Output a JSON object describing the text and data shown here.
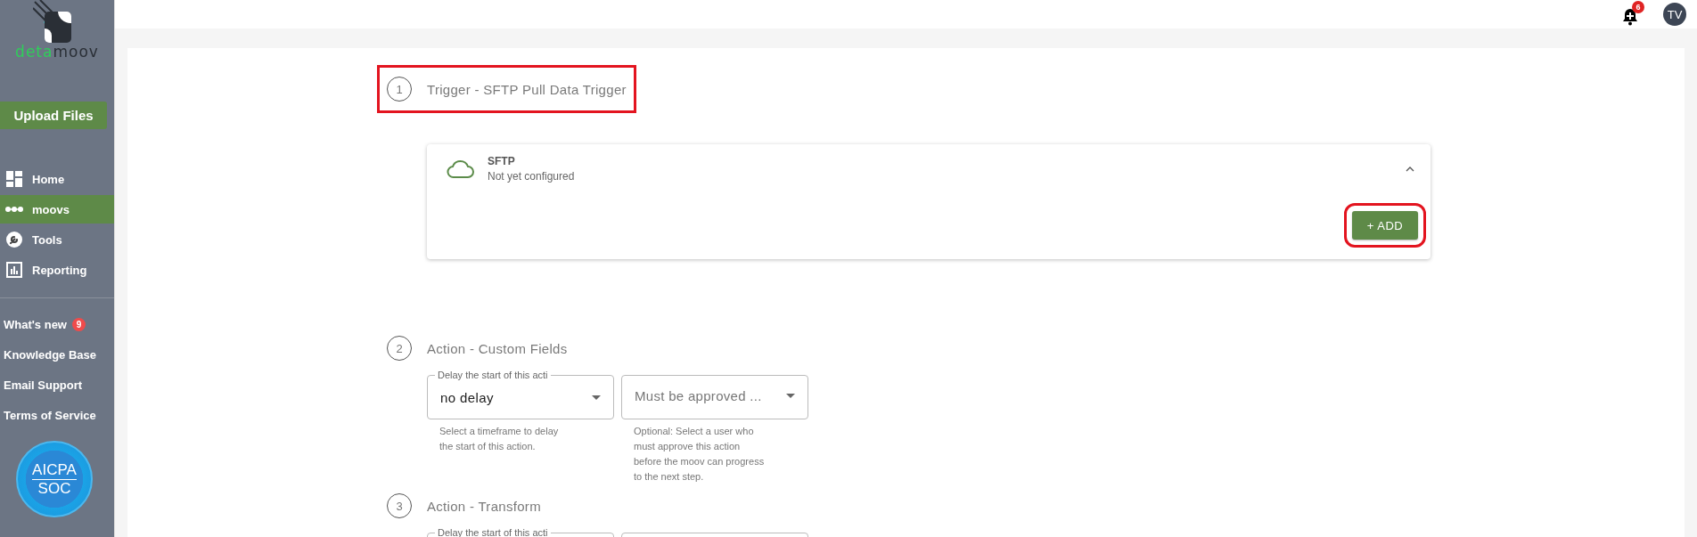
{
  "sidebar": {
    "logo": {
      "part1": "deta",
      "part2": "moov"
    },
    "upload_button": "Upload Files",
    "nav": [
      {
        "label": "Home",
        "selected": false
      },
      {
        "label": "moovs",
        "selected": true
      },
      {
        "label": "Tools",
        "selected": false
      },
      {
        "label": "Reporting",
        "selected": false
      }
    ],
    "links": [
      {
        "label": "What's new",
        "badge": "9"
      },
      {
        "label": "Knowledge Base"
      },
      {
        "label": "Email Support"
      },
      {
        "label": "Terms of Service"
      }
    ],
    "certification": {
      "line1": "AICPA",
      "line2": "SOC"
    }
  },
  "top_bar": {
    "notifications": "6",
    "avatar": "TV"
  },
  "steps": [
    {
      "number": "1",
      "title": "Trigger - SFTP Pull Data Trigger",
      "highlighted": true,
      "kind": "trigger",
      "card": {
        "title": "SFTP",
        "subtitle": "Not yet configured",
        "expanded": true,
        "button": {
          "label": "+ ADD",
          "highlighted": true
        }
      }
    },
    {
      "number": "2",
      "title": "Action - Custom Fields",
      "highlighted": false,
      "kind": "action",
      "fields": [
        {
          "kind": "select",
          "label": "Delay the start of this acti",
          "value": "no delay",
          "helper": "Select a timeframe to delay the start of this action."
        },
        {
          "kind": "select",
          "placeholder": "Must be approved ...",
          "helper": "Optional: Select a user who must approve this action before the moov can progress to the next step."
        }
      ]
    },
    {
      "number": "3",
      "title": "Action - Transform",
      "highlighted": false,
      "kind": "action",
      "fields": [
        {
          "kind": "select",
          "label": "Delay the start of this acti"
        },
        {
          "kind": "select"
        }
      ]
    }
  ]
}
